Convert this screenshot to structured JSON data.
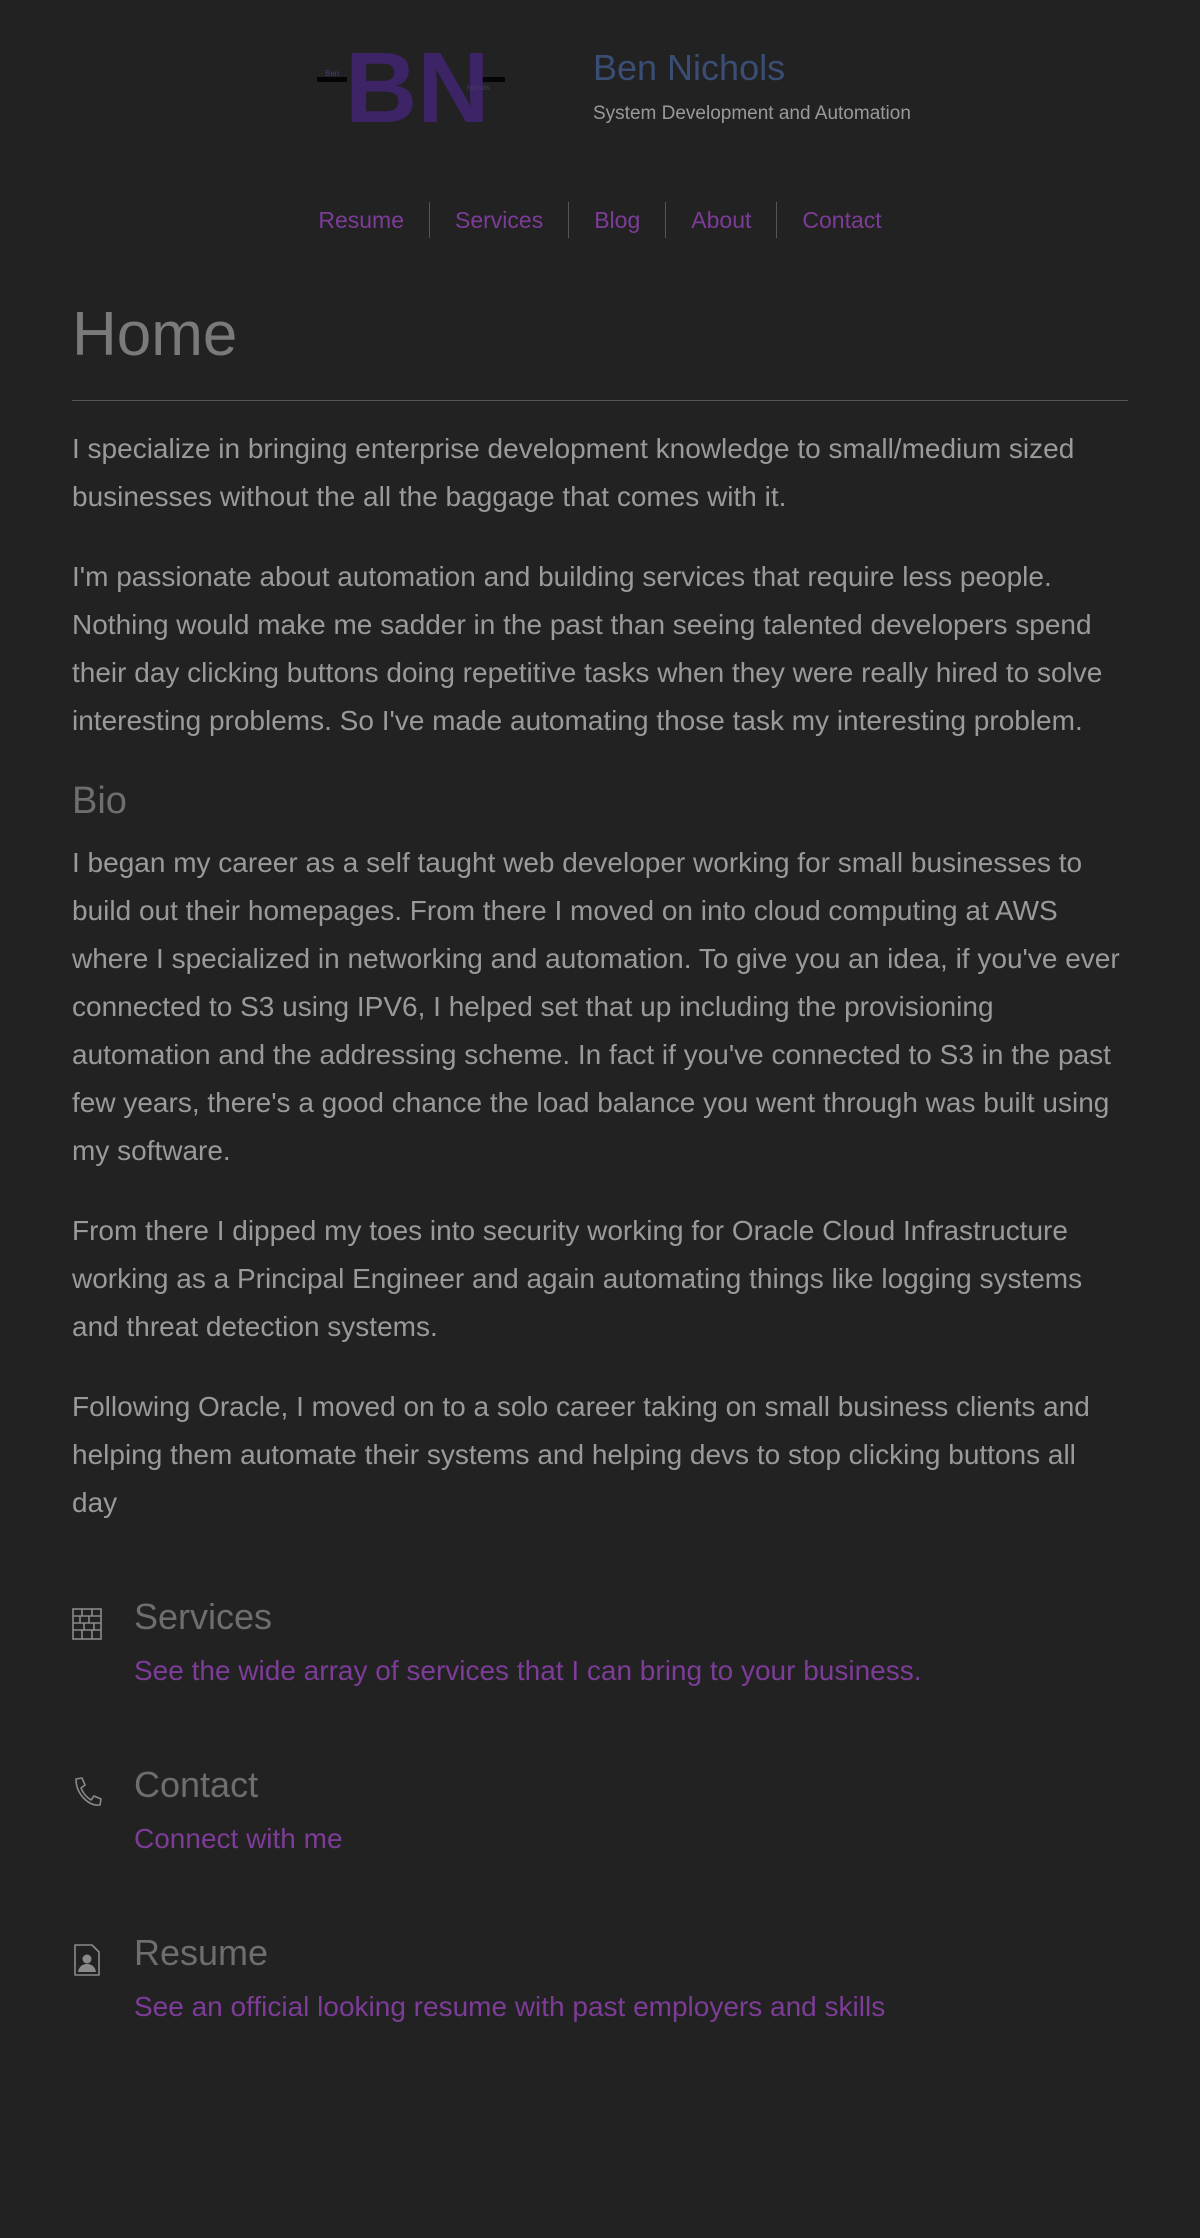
{
  "header": {
    "logo": {
      "letters": "BN",
      "small_left": "Ben",
      "small_right": "Nichols"
    },
    "title": "Ben Nichols",
    "subtitle": "System Development and Automation"
  },
  "nav": {
    "items": [
      {
        "label": "Resume"
      },
      {
        "label": "Services"
      },
      {
        "label": "Blog"
      },
      {
        "label": "About"
      },
      {
        "label": "Contact"
      }
    ]
  },
  "main": {
    "heading": "Home",
    "intro": [
      "I specialize in bringing enterprise development knowledge to small/medium sized businesses without the all the baggage that comes with it.",
      "I'm passionate about automation and building services that require less people. Nothing would make me sadder in the past than seeing talented developers spend their day clicking buttons doing repetitive tasks when they were really hired to solve interesting problems. So I've made automating those task my interesting problem."
    ],
    "bio_heading": "Bio",
    "bio": [
      "I began my career as a self taught web developer working for small businesses to build out their homepages. From there I moved on into cloud computing at AWS where I specialized in networking and automation. To give you an idea, if you've ever connected to S3 using IPV6, I helped set that up including the provisioning automation and the addressing scheme. In fact if you've connected to S3 in the past few years, there's a good chance the load balance you went through was built using my software.",
      "From there I dipped my toes into security working for Oracle Cloud Infrastructure working as a Principal Engineer and again automating things like logging systems and threat detection systems.",
      "Following Oracle, I moved on to a solo career taking on small business clients and helping them automate their systems and helping devs to stop clicking buttons all day"
    ]
  },
  "features": [
    {
      "icon": "building-icon",
      "title": "Services",
      "link": "See the wide array of services that I can bring to your business."
    },
    {
      "icon": "phone-icon",
      "title": "Contact",
      "link": "Connect with me"
    },
    {
      "icon": "resume-icon",
      "title": "Resume",
      "link": "See an official looking resume with past employers and skills"
    }
  ],
  "colors": {
    "background": "#222222",
    "accent": "#7d3c98",
    "title": "#3a4e75",
    "text": "#9a9a9a"
  }
}
